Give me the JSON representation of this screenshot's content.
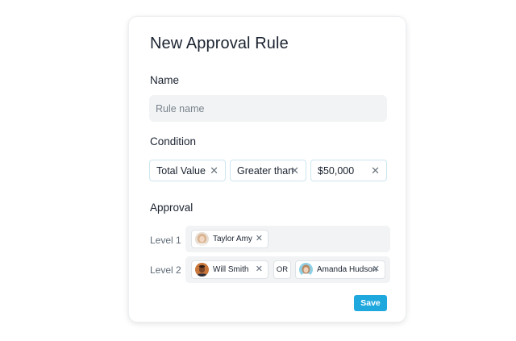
{
  "dialog": {
    "title": "New Approval Rule",
    "name_section": {
      "label": "Name",
      "placeholder": "Rule name",
      "value": ""
    },
    "condition_section": {
      "label": "Condition",
      "chips": [
        {
          "label": "Total Value",
          "remove_icon": "close-icon"
        },
        {
          "label": "Greater than",
          "remove_icon": "close-icon"
        },
        {
          "label": "$50,000",
          "remove_icon": "close-icon"
        }
      ]
    },
    "approval_section": {
      "label": "Approval",
      "levels": [
        {
          "label": "Level 1",
          "approvers": [
            {
              "name": "Taylor Amy",
              "avatar": "avatar-photo-icon"
            }
          ]
        },
        {
          "label": "Level 2",
          "approvers": [
            {
              "name": "Will Smith",
              "avatar": "avatar-photo-icon"
            },
            {
              "name": "Amanda Hudson",
              "avatar": "avatar-photo-icon"
            }
          ],
          "connector": "OR"
        }
      ]
    },
    "save_label": "Save"
  },
  "colors": {
    "accent": "#1fa8de",
    "chip_border": "#cde6ef",
    "field_bg": "#f1f3f4"
  }
}
